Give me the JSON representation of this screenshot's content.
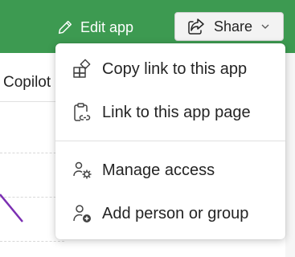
{
  "header": {
    "edit_app_label": "Edit app",
    "share_label": "Share",
    "icons": {
      "edit": "pencil-icon",
      "share": "share-icon",
      "dropdown": "chevron-down-icon"
    }
  },
  "background": {
    "copilot_label": "Copilot"
  },
  "share_menu": {
    "items": [
      {
        "label": "Copy link to this app",
        "icon": "app-link-icon"
      },
      {
        "label": "Link to this app page",
        "icon": "page-link-icon"
      },
      {
        "label": "Manage access",
        "icon": "manage-access-icon"
      },
      {
        "label": "Add person or group",
        "icon": "add-person-icon"
      }
    ]
  },
  "colors": {
    "header_green": "#3d9a51",
    "text": "#242424",
    "accent_purple": "#7b2fb2"
  }
}
